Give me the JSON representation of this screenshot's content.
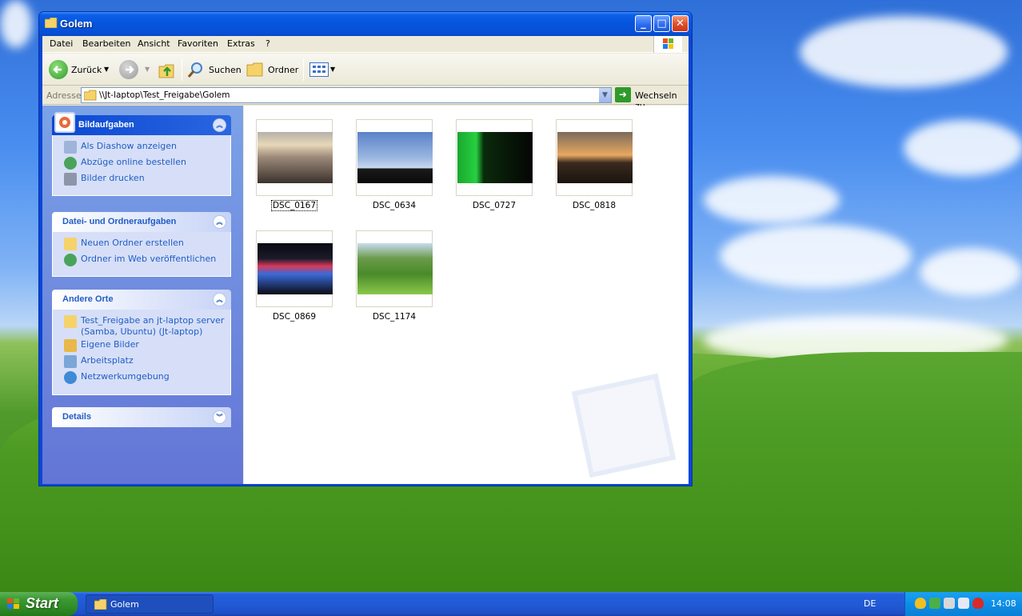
{
  "window": {
    "title": "Golem"
  },
  "menu": [
    "Datei",
    "Bearbeiten",
    "Ansicht",
    "Favoriten",
    "Extras",
    "?"
  ],
  "toolbar": {
    "back_label": "Zurück",
    "search_label": "Suchen",
    "folders_label": "Ordner"
  },
  "address": {
    "label": "Adresse",
    "path": "\\\\Jt-laptop\\Test_Freigabe\\Golem",
    "go_label": "Wechseln zu"
  },
  "panels": {
    "picture_tasks": {
      "title": "Bildaufgaben",
      "items": [
        "Als Diashow anzeigen",
        "Abzüge online bestellen",
        "Bilder drucken"
      ]
    },
    "file_tasks": {
      "title": "Datei- und Ordneraufgaben",
      "items": [
        "Neuen Ordner erstellen",
        "Ordner im Web veröffentlichen"
      ]
    },
    "other_places": {
      "title": "Andere Orte",
      "items": [
        "Test_Freigabe an jt-laptop server (Samba, Ubuntu) (Jt-laptop)",
        "Eigene Bilder",
        "Arbeitsplatz",
        "Netzwerkumgebung"
      ]
    },
    "details": {
      "title": "Details"
    }
  },
  "files": [
    {
      "name": "DSC_0167",
      "selected": true
    },
    {
      "name": "DSC_0634",
      "selected": false
    },
    {
      "name": "DSC_0727",
      "selected": false
    },
    {
      "name": "DSC_0818",
      "selected": false
    },
    {
      "name": "DSC_0869",
      "selected": false
    },
    {
      "name": "DSC_1174",
      "selected": false
    }
  ],
  "taskbar": {
    "start_label": "Start",
    "task_label": "Golem",
    "language": "DE",
    "clock": "14:08"
  }
}
